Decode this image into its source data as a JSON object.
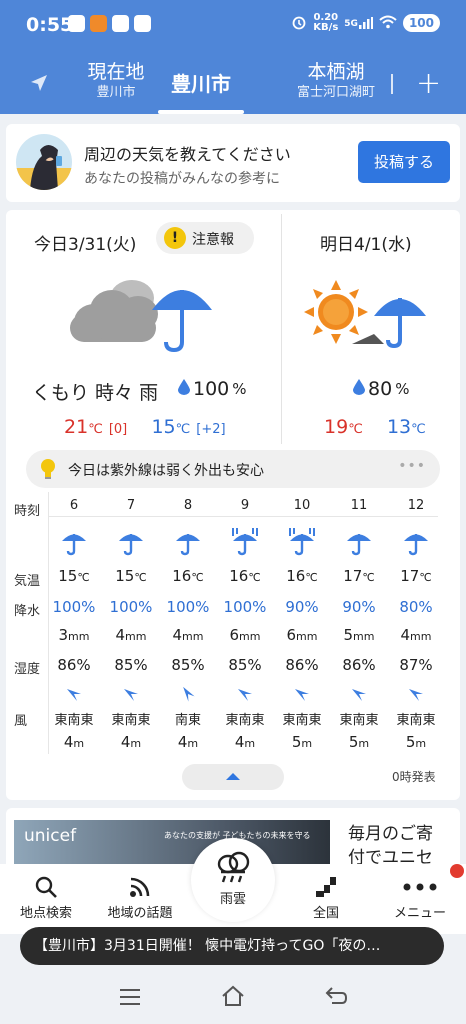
{
  "status": {
    "time": "0:55",
    "net_speed_top": "0.20",
    "net_speed_unit": "KB/s",
    "signal": "5G",
    "battery": "100"
  },
  "tabs": [
    {
      "label": "現在地",
      "sub": "豊川市"
    },
    {
      "label": "豊川市",
      "sub": ""
    },
    {
      "label": "本栖湖",
      "sub": "富士河口湖町"
    }
  ],
  "post": {
    "title": "周辺の天気を教えてください",
    "subtitle": "あなたの投稿がみんなの参考に",
    "button": "投稿する"
  },
  "today": {
    "date": "今日3/31(火)",
    "advisory": "注意報",
    "weather": "くもり 時々 雨",
    "precip": "100",
    "precip_unit": "%",
    "high": "21",
    "high_diff": "[0]",
    "low": "15",
    "low_diff": "[+2]",
    "temp_unit": "℃"
  },
  "tomorrow": {
    "date": "明日4/1(水)",
    "precip": "80",
    "precip_unit": "%",
    "high": "19",
    "low": "13",
    "temp_unit": "℃"
  },
  "uv": {
    "text": "今日は紫外線は弱く外出も安心",
    "more": "•••"
  },
  "hourly": {
    "labels": {
      "time": "時刻",
      "temp": "気温",
      "precip": "降水",
      "humidity": "湿度",
      "wind": "風"
    },
    "hours": [
      "6",
      "7",
      "8",
      "9",
      "10",
      "11",
      "12"
    ],
    "icons": [
      "umbrella",
      "umbrella",
      "umbrella",
      "heavy-rain-umbrella",
      "heavy-rain-umbrella",
      "umbrella",
      "umbrella"
    ],
    "temps": [
      "15",
      "15",
      "16",
      "16",
      "16",
      "17",
      "17"
    ],
    "temp_unit": "℃",
    "precip_pct": [
      "100%",
      "100%",
      "100%",
      "100%",
      "90%",
      "90%",
      "80%"
    ],
    "precip_mm": [
      "3",
      "4",
      "4",
      "6",
      "6",
      "5",
      "4"
    ],
    "mm_unit": "mm",
    "humidity": [
      "86%",
      "85%",
      "85%",
      "85%",
      "86%",
      "86%",
      "87%"
    ],
    "wind_dir": [
      "東南東",
      "東南東",
      "南東",
      "東南東",
      "東南東",
      "東南東",
      "東南東"
    ],
    "wind_speed": [
      "4",
      "4",
      "4",
      "4",
      "5",
      "5",
      "5"
    ],
    "speed_unit": "m"
  },
  "issued": "0時発表",
  "ad": {
    "logo": "unicef",
    "caption": "あなたの支援が 子どもたちの未来を守る",
    "text_line1": "毎月のご寄",
    "text_line2": "付でユニセ"
  },
  "nav": {
    "search": "地点検索",
    "topics": "地域の話題",
    "rain": "雨雲",
    "nationwide": "全国",
    "menu": "メニュー"
  },
  "ticker": "【豊川市】3月31日開催！ 懐中電灯持ってGO「夜の…",
  "colors": {
    "brand_blue": "#4f86d8",
    "button_blue": "#2f76e0",
    "high_red": "#d9322a",
    "low_blue": "#2f6fd3",
    "umbrella_blue": "#3d7ee0"
  }
}
